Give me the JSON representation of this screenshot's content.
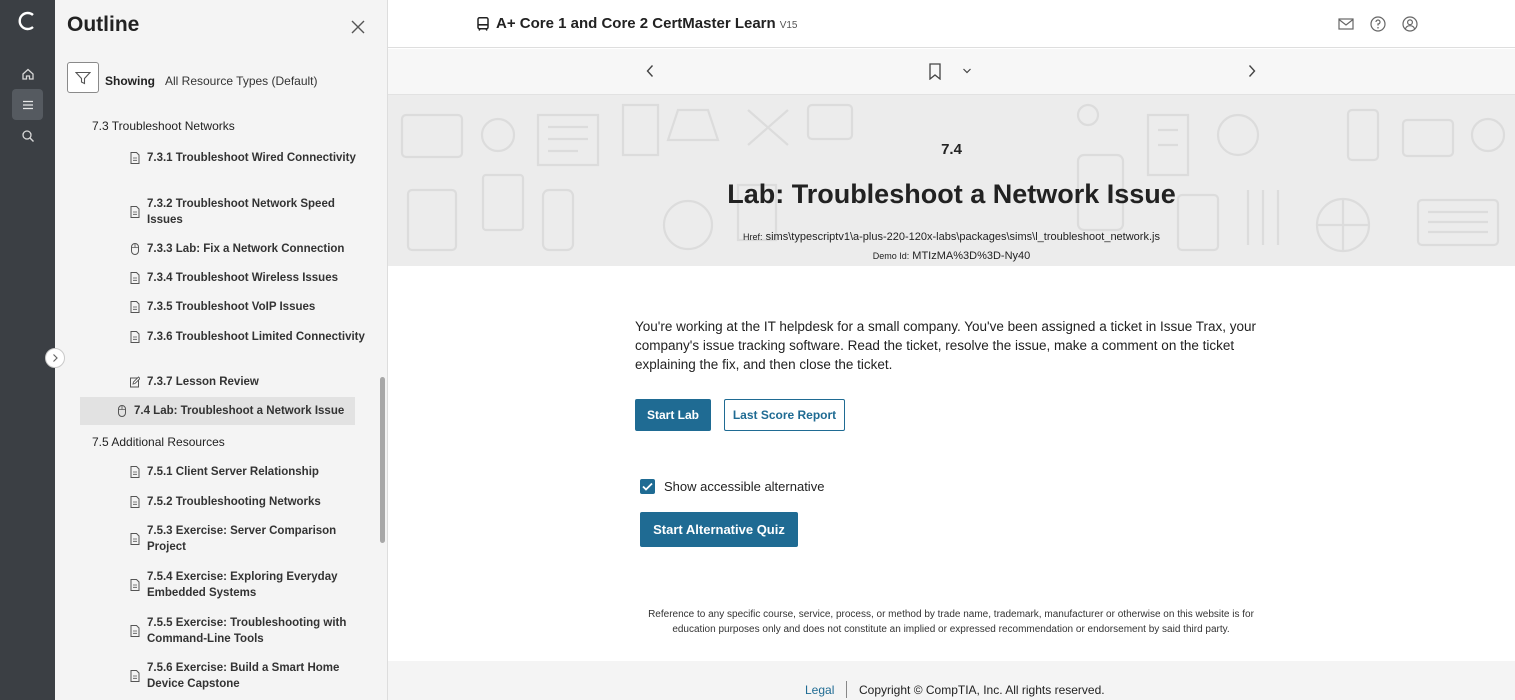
{
  "app": {
    "title": "A+ Core 1 and Core 2 CertMaster Learn",
    "version": "V15"
  },
  "outline": {
    "heading": "Outline",
    "filter_label": "Showing",
    "filter_value": "All Resource Types (Default)",
    "sections": [
      {
        "label": "7.3 Troubleshoot Networks"
      },
      {
        "label": "7.5 Additional Resources"
      }
    ],
    "items": [
      {
        "label": "7.3.1 Troubleshoot Wired Connectivity",
        "icon": "page-icon"
      },
      {
        "label": "7.3.2 Troubleshoot Network Speed Issues",
        "icon": "page-icon"
      },
      {
        "label": "7.3.3 Lab: Fix a Network Connection",
        "icon": "mouse-icon"
      },
      {
        "label": "7.3.4 Troubleshoot Wireless Issues",
        "icon": "page-icon"
      },
      {
        "label": "7.3.5 Troubleshoot VoIP Issues",
        "icon": "page-icon"
      },
      {
        "label": "7.3.6 Troubleshoot Limited Connectivity",
        "icon": "page-icon"
      },
      {
        "label": "7.3.7 Lesson Review",
        "icon": "edit-icon"
      },
      {
        "label": "7.4 Lab: Troubleshoot a Network Issue",
        "icon": "mouse-icon"
      },
      {
        "label": "7.5.1 Client Server Relationship",
        "icon": "page-icon"
      },
      {
        "label": "7.5.2 Troubleshooting Networks",
        "icon": "page-icon"
      },
      {
        "label": "7.5.3 Exercise: Server Comparison Project",
        "icon": "page-icon"
      },
      {
        "label": "7.5.4 Exercise: Exploring Everyday Embedded Systems",
        "icon": "page-icon"
      },
      {
        "label": "7.5.5 Exercise: Troubleshooting with Command-Line Tools",
        "icon": "page-icon"
      },
      {
        "label": "7.5.6 Exercise: Build a Smart Home Device Capstone",
        "icon": "page-icon"
      }
    ]
  },
  "hero": {
    "number": "7.4",
    "title": "Lab: Troubleshoot a Network Issue",
    "href_label": "Href:",
    "href_value": "sims\\typescriptv1\\a-plus-220-120x-labs\\packages\\sims\\l_troubleshoot_network.js",
    "demo_label": "Demo Id:",
    "demo_value": "MTIzMA%3D%3D-Ny40"
  },
  "main": {
    "description": "You're working at the IT helpdesk for a small company. You've been assigned a ticket in Issue Trax, your company's issue tracking software. Read the ticket, resolve the issue, make a comment on the ticket explaining the fix, and then close the ticket.",
    "start_lab": "Start Lab",
    "last_score": "Last Score Report",
    "accessible_label": "Show accessible alternative",
    "accessible_checked": true,
    "alt_quiz": "Start Alternative Quiz",
    "disclaimer": "Reference to any specific course, service, process, or method by trade name, trademark, manufacturer or otherwise on this website is for education purposes only and does not constitute an implied or expressed recommendation or endorsement by said third party."
  },
  "footer": {
    "legal": "Legal",
    "copyright": "Copyright © CompTIA, Inc. All rights reserved."
  },
  "colors": {
    "accent": "#1f6b93",
    "rail": "#3b3f44",
    "sidebar": "#f4f4f4"
  }
}
